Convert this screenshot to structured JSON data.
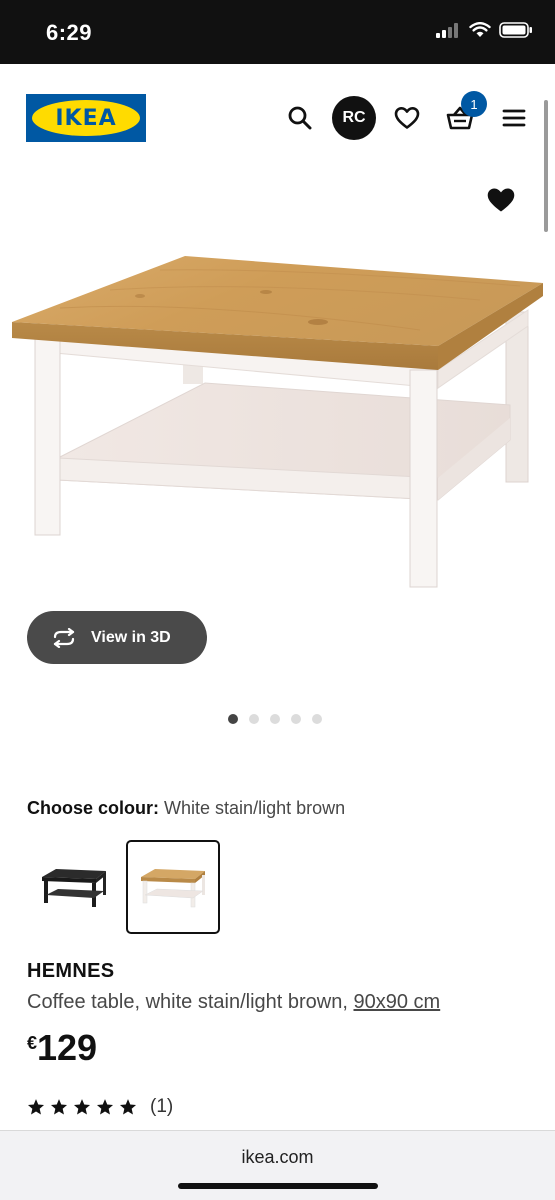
{
  "status_bar": {
    "time": "6:29"
  },
  "header": {
    "logo_text": "IKEA",
    "avatar_initials": "RC",
    "cart_count": "1"
  },
  "view3d": {
    "label": "View in 3D"
  },
  "carousel": {
    "total": 5,
    "active_index": 0
  },
  "colour": {
    "label": "Choose colour:",
    "value": "White stain/light brown"
  },
  "product": {
    "name": "HEMNES",
    "description": "Coffee table, white stain/light brown, ",
    "size": "90x90 cm",
    "currency": "€",
    "price": "129",
    "rating": 5,
    "review_count": "(1)"
  },
  "browser": {
    "url": "ikea.com"
  },
  "colors": {
    "brand_blue": "#0058a3",
    "brand_yellow": "#ffdb00",
    "button_dark": "#4a4a4a"
  }
}
